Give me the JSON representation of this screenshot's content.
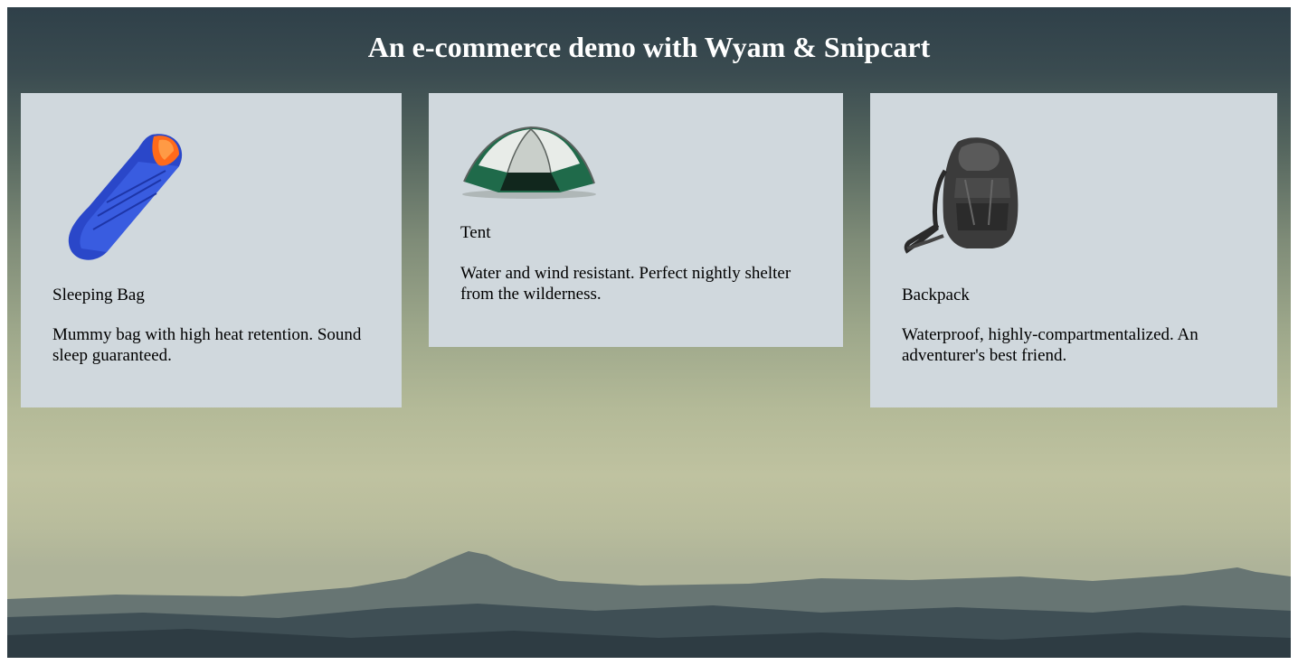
{
  "page": {
    "title": "An e-commerce demo with Wyam & Snipcart"
  },
  "products": [
    {
      "name": "Sleeping Bag",
      "description": "Mummy bag with high heat retention. Sound sleep guaranteed.",
      "image_icon": "sleeping-bag-image"
    },
    {
      "name": "Tent",
      "description": "Water and wind resistant. Perfect nightly shelter from the wilderness.",
      "image_icon": "tent-image"
    },
    {
      "name": "Backpack",
      "description": "Waterproof, highly-compartmentalized. An adventurer's best friend.",
      "image_icon": "backpack-image"
    }
  ],
  "colors": {
    "card_background": "#d0d8dd",
    "title_text": "#ffffff",
    "sky_top": "#2f4049",
    "sky_bottom": "#bfc2a0"
  }
}
